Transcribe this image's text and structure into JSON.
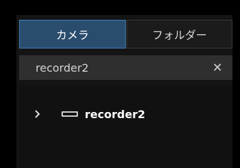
{
  "tabs": [
    {
      "label": "カメラ",
      "active": true
    },
    {
      "label": "フォルダー",
      "active": false
    }
  ],
  "search": {
    "value": "recorder2",
    "clear_icon": "close-icon"
  },
  "tree": {
    "items": [
      {
        "label": "recorder2",
        "icon": "recorder-device-icon",
        "expanded": false
      }
    ]
  },
  "colors": {
    "active_tab_bg": "#2a4d6e",
    "active_tab_border": "#3f7fb8",
    "panel_bg": "#141414",
    "search_bg": "#2f2f2f"
  }
}
